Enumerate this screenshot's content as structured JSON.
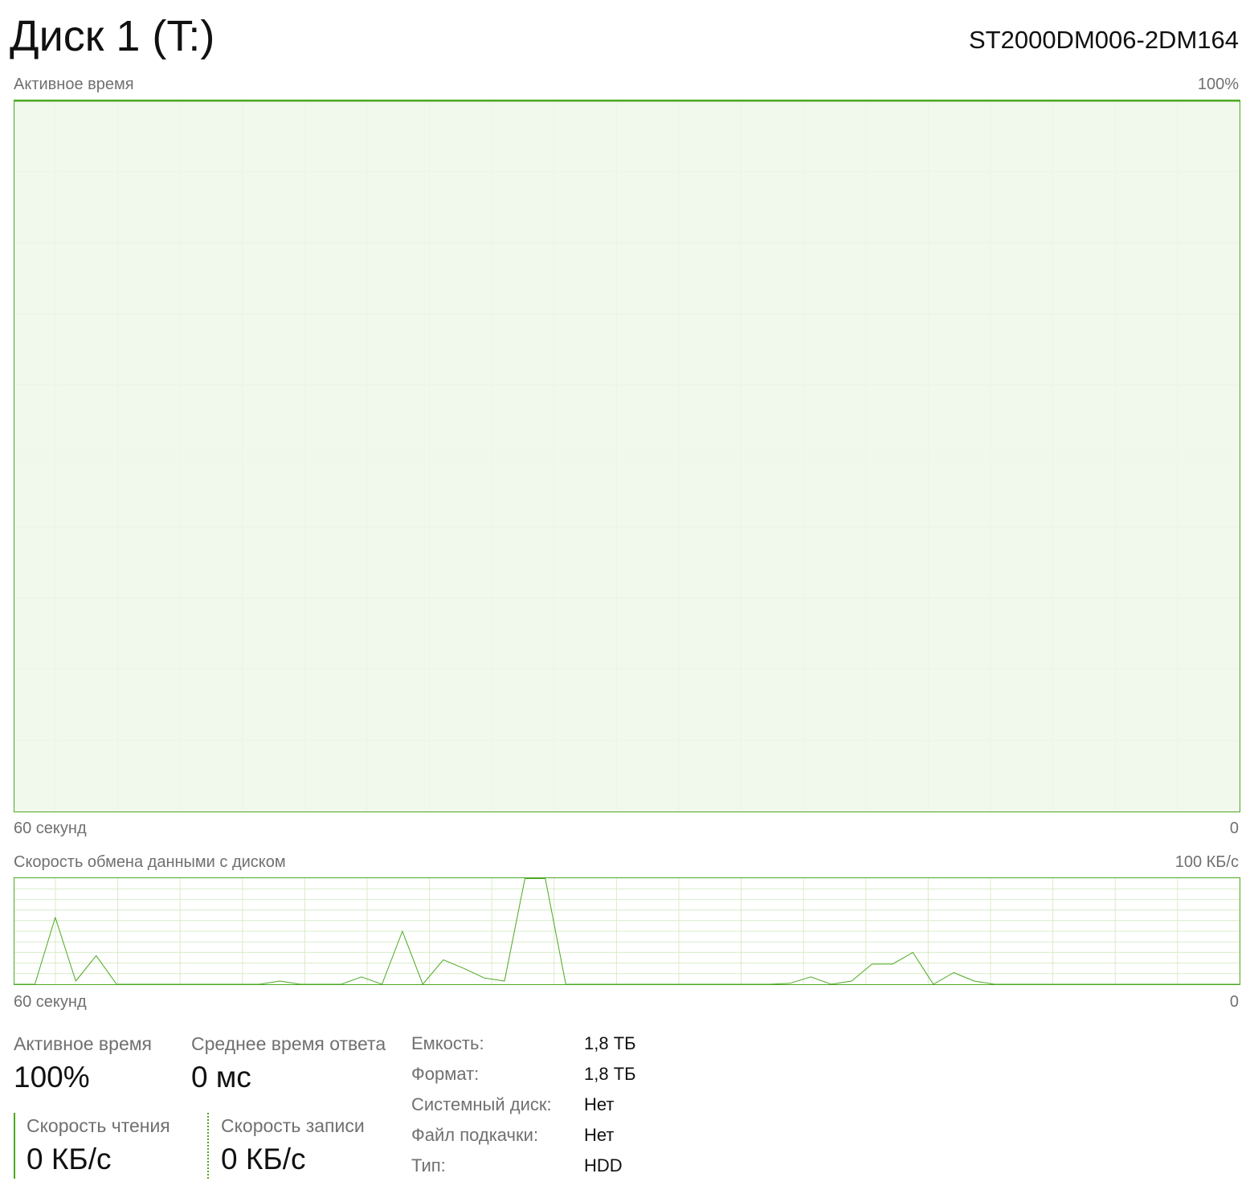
{
  "header": {
    "title": "Диск 1 (T:)",
    "model": "ST2000DM006-2DM164"
  },
  "active_chart": {
    "label": "Активное время",
    "max_label": "100%",
    "time_left": "60 секунд",
    "time_right": "0"
  },
  "transfer_chart": {
    "label": "Скорость обмена данными с диском",
    "max_label": "100 КБ/с",
    "time_left": "60 секунд",
    "time_right": "0"
  },
  "stats": {
    "active_time_label": "Активное время",
    "active_time_value": "100%",
    "avg_response_label": "Среднее время ответа",
    "avg_response_value": "0 мс",
    "read_speed_label": "Скорость чтения",
    "read_speed_value": "0 КБ/с",
    "write_speed_label": "Скорость записи",
    "write_speed_value": "0 КБ/с"
  },
  "properties": [
    {
      "label": "Емкость:",
      "value": "1,8 ТБ"
    },
    {
      "label": "Формат:",
      "value": "1,8 ТБ"
    },
    {
      "label": "Системный диск:",
      "value": "Нет"
    },
    {
      "label": "Файл подкачки:",
      "value": "Нет"
    },
    {
      "label": "Тип:",
      "value": "HDD"
    }
  ],
  "colors": {
    "line": "#4ca820",
    "fill": "#eff7e9",
    "grid": "#d8ecca"
  },
  "chart_data": [
    {
      "type": "area",
      "title": "Активное время",
      "x": [
        60,
        58,
        56,
        54,
        52,
        50,
        48,
        46,
        44,
        42,
        40,
        38,
        36,
        34,
        32,
        30,
        28,
        26,
        24,
        22,
        20,
        18,
        16,
        14,
        12,
        10,
        8,
        6,
        4,
        2,
        0
      ],
      "values": [
        100,
        100,
        100,
        100,
        100,
        100,
        100,
        100,
        100,
        100,
        100,
        100,
        100,
        100,
        100,
        100,
        100,
        100,
        100,
        100,
        100,
        100,
        100,
        100,
        100,
        100,
        100,
        100,
        100,
        100,
        100
      ],
      "xlabel": "60 секунд",
      "ylim": [
        0,
        100
      ],
      "grid": true
    },
    {
      "type": "line",
      "title": "Скорость обмена данными с диском",
      "x": [
        60,
        59,
        58,
        57,
        56,
        55,
        54,
        53,
        52,
        51,
        50,
        49,
        48,
        47,
        46,
        45,
        44,
        43,
        42,
        41,
        40,
        39,
        38,
        37,
        36,
        35,
        34,
        33,
        32,
        31,
        30,
        29,
        28,
        27,
        26,
        25,
        24,
        23,
        22,
        21,
        20,
        19,
        18,
        17,
        16,
        15,
        14,
        13,
        12,
        11,
        10,
        9,
        8,
        7,
        6,
        5,
        4,
        3,
        2,
        1,
        0
      ],
      "values": [
        0,
        0,
        63,
        3,
        27,
        0,
        0,
        0,
        0,
        0,
        0,
        0,
        0,
        3,
        0,
        0,
        0,
        7,
        0,
        50,
        0,
        23,
        15,
        6,
        3,
        100,
        100,
        0,
        0,
        0,
        0,
        0,
        0,
        0,
        0,
        0,
        0,
        0,
        1,
        7,
        0,
        3,
        19,
        19,
        30,
        0,
        11,
        3,
        0,
        0,
        0,
        0,
        0,
        0,
        0,
        0,
        0,
        0,
        0,
        0,
        0
      ],
      "xlabel": "60 секунд",
      "ylim": [
        0,
        100
      ],
      "grid": true
    }
  ]
}
